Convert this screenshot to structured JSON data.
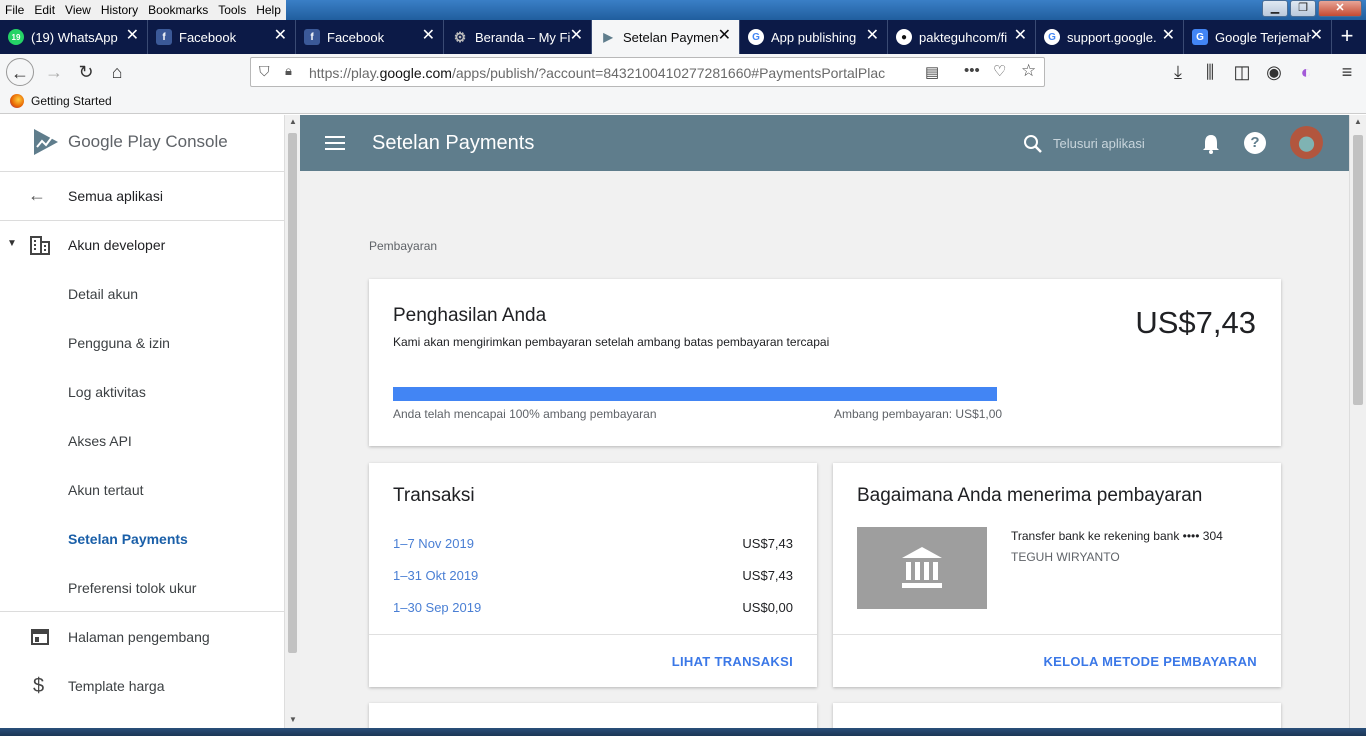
{
  "browser": {
    "menu": [
      "File",
      "Edit",
      "View",
      "History",
      "Bookmarks",
      "Tools",
      "Help"
    ],
    "tabs": [
      {
        "label": "(19) WhatsApp",
        "icon": "whatsapp-icon",
        "color": "#25d366",
        "glyph": "19"
      },
      {
        "label": "Facebook",
        "icon": "facebook-icon",
        "color": "#3b5998",
        "glyph": "f"
      },
      {
        "label": "Facebook",
        "icon": "facebook-icon",
        "color": "#3b5998",
        "glyph": "f"
      },
      {
        "label": "Beranda – My Fi",
        "icon": "gear-icon",
        "color": "#888888",
        "glyph": "⚙"
      },
      {
        "label": "Setelan Payment",
        "icon": "play-console-icon",
        "color": "#5f7d8c",
        "glyph": "▶",
        "active": true
      },
      {
        "label": "App publishing",
        "icon": "google-icon",
        "color": "#ffffff",
        "glyph": "G"
      },
      {
        "label": "pakteguhcom/fi",
        "icon": "github-icon",
        "color": "#222222",
        "glyph": "●"
      },
      {
        "label": "support.google.",
        "icon": "google-icon",
        "color": "#ffffff",
        "glyph": "G"
      },
      {
        "label": "Google Terjemah",
        "icon": "translate-icon",
        "color": "#4285f4",
        "glyph": "G"
      }
    ],
    "url_prefix": "https://play.",
    "url_domain": "google.com",
    "url_rest": "/apps/publish/?account=8432100410277281660#PaymentsPortalPlac",
    "bookmark": "Getting Started"
  },
  "sidebar": {
    "logo_text": "Google Play Console",
    "back_label": "Semua aplikasi",
    "section_label": "Akun developer",
    "items": [
      {
        "label": "Detail akun"
      },
      {
        "label": "Pengguna & izin"
      },
      {
        "label": "Log aktivitas"
      },
      {
        "label": "Akses API"
      },
      {
        "label": "Akun tertaut"
      },
      {
        "label": "Setelan Payments"
      },
      {
        "label": "Preferensi tolok ukur"
      }
    ],
    "dev_page_label": "Halaman pengembang",
    "pricing_label": "Template harga"
  },
  "topbar": {
    "title": "Setelan Payments",
    "search_placeholder": "Telusuri aplikasi"
  },
  "page": {
    "breadcrumb": "Pembayaran",
    "earnings": {
      "title": "Penghasilan Anda",
      "subtitle": "Kami akan mengirimkan pembayaran setelah ambang batas pembayaran tercapai",
      "amount": "US$7,43",
      "progress_fraction": 1.0,
      "progress_left": "Anda telah mencapai 100% ambang pembayaran",
      "progress_right": "Ambang pembayaran: US$1,00"
    },
    "transactions": {
      "title": "Transaksi",
      "rows": [
        {
          "period": "1–7 Nov 2019",
          "amount": "US$7,43"
        },
        {
          "period": "1–31 Okt 2019",
          "amount": "US$7,43"
        },
        {
          "period": "1–30 Sep 2019",
          "amount": "US$0,00"
        }
      ],
      "action": "LIHAT TRANSAKSI"
    },
    "payment_method": {
      "title": "Bagaimana Anda menerima pembayaran",
      "method": "Transfer bank ke rekening bank •••• 304",
      "holder": "TEGUH WIRYANTO",
      "action": "KELOLA METODE PEMBAYARAN"
    }
  },
  "colors": {
    "topbar": "#5f7d8c",
    "progress": "#4285f4",
    "link": "#4a7fd4",
    "active_nav": "#1a5fa8"
  }
}
